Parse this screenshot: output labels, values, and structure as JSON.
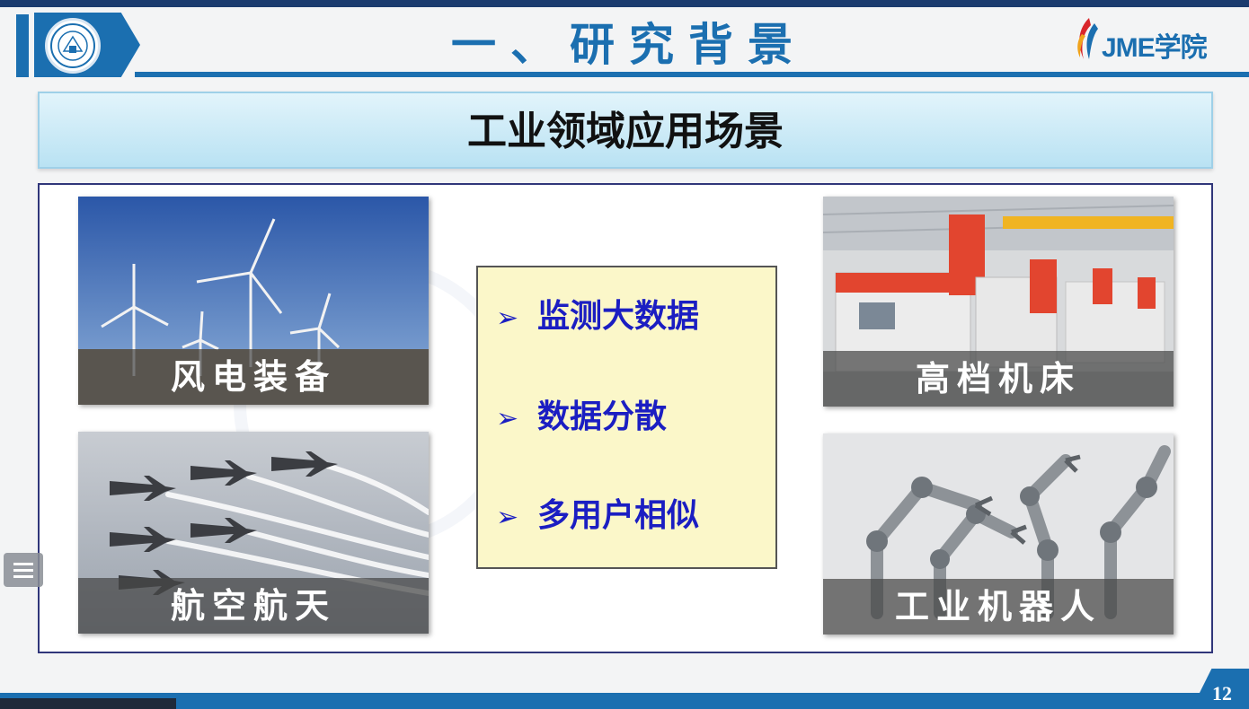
{
  "header": {
    "title": "一、研究背景",
    "brand": "JME学院"
  },
  "banner": {
    "title": "工业领域应用场景"
  },
  "tiles": [
    {
      "label": "风电装备"
    },
    {
      "label": "航空航天"
    },
    {
      "label": "高档机床"
    },
    {
      "label": "工业机器人"
    }
  ],
  "points": {
    "bullet": "➢",
    "items": [
      "监测大数据",
      "数据分散",
      "多用户相似"
    ]
  },
  "footer": {
    "page_number": "12"
  },
  "colors": {
    "accent": "#1b6fb0",
    "point_text": "#1b1ec2",
    "box_fill": "#fbf7c9"
  },
  "icons": [
    "university-seal-icon",
    "brand-flame-icon",
    "menu-icon"
  ]
}
